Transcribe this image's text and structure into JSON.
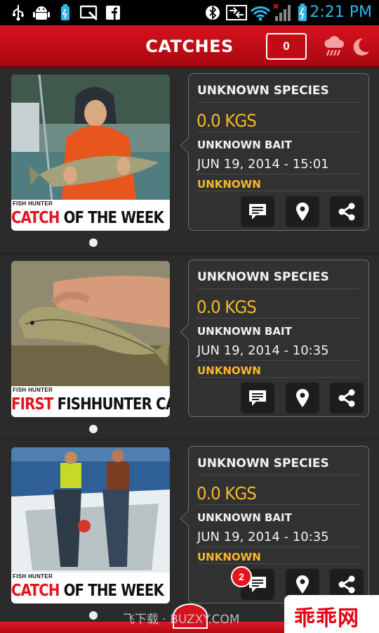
{
  "status_bar": {
    "time": "2:21 PM",
    "left_icons": [
      "usb-icon",
      "android-icon",
      "battery-saver-icon",
      "screen-cast-icon",
      "facebook-icon"
    ],
    "right_icons": [
      "bluetooth-icon",
      "data-transfer-icon",
      "wifi-icon",
      "signal-icon",
      "battery-charging-icon"
    ]
  },
  "header": {
    "title": "CATCHES",
    "count": "0",
    "icons": [
      "rain-cloud-icon",
      "moon-icon"
    ]
  },
  "catches": [
    {
      "species": "UNKNOWN SPECIES",
      "weight": "0.0 KGS",
      "bait": "UNKNOWN BAIT",
      "date": "JUN 19, 2014 -  15:01",
      "location": "UNKNOWN",
      "photo_brand": "FISH HUNTER",
      "caption_red": "CATCH",
      "caption_dark": " OF THE WEEK",
      "comment_badge": ""
    },
    {
      "species": "UNKNOWN SPECIES",
      "weight": "0.0 KGS",
      "bait": "UNKNOWN BAIT",
      "date": "JUN 19, 2014 -  10:35",
      "location": "UNKNOWN",
      "photo_brand": "FISH HUNTER",
      "caption_red": "FIRST",
      "caption_dark": " FISHHUNTER CATCH",
      "comment_badge": ""
    },
    {
      "species": "UNKNOWN SPECIES",
      "weight": "0.0 KGS",
      "bait": "UNKNOWN BAIT",
      "date": "JUN 19, 2014 -  10:35",
      "location": "UNKNOWN",
      "photo_brand": "FISH HUNTER",
      "caption_red": "CATCH",
      "caption_dark": " OF THE WEEK",
      "comment_badge": "2"
    }
  ],
  "footer": {
    "watermark": "飞下载 · BUZXY.COM",
    "corner_brand": "乖乖网"
  },
  "colors": {
    "header_red": "#d8121e",
    "accent_yellow": "#f7b72b",
    "card_bg": "#313131",
    "background": "#2b2b2b"
  }
}
